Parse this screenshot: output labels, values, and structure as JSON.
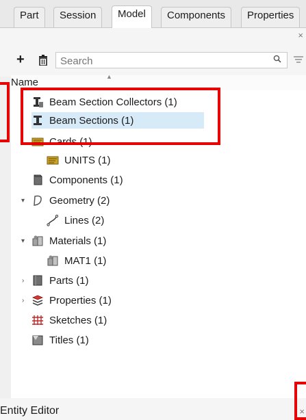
{
  "tabs": [
    {
      "label": "Part",
      "active": false
    },
    {
      "label": "Session",
      "active": false
    },
    {
      "label": "Model",
      "active": true
    },
    {
      "label": "Components",
      "active": false
    },
    {
      "label": "Properties",
      "active": false
    }
  ],
  "panel_close": "×",
  "toolbar": {
    "add_label": "+",
    "search_placeholder": "Search"
  },
  "header": {
    "name": "Name"
  },
  "tree": [
    {
      "label": "Beam Section Collectors",
      "count": "(1)",
      "icon": "beam-section-collector-icon",
      "selected": false
    },
    {
      "label": "Beam Sections",
      "count": "(1)",
      "icon": "beam-section-icon",
      "selected": true
    },
    {
      "label": "Cards",
      "count": "(1)",
      "icon": "card-icon",
      "selected": false
    },
    {
      "label": "UNITS",
      "count": "(1)",
      "icon": "card-icon",
      "selected": false
    },
    {
      "label": "Components",
      "count": "(1)",
      "icon": "component-icon",
      "selected": false
    },
    {
      "label": "Geometry",
      "count": "(2)",
      "icon": "geometry-icon",
      "expanded": true
    },
    {
      "label": "Lines",
      "count": "(2)",
      "icon": "line-icon",
      "selected": false
    },
    {
      "label": "Materials",
      "count": "(1)",
      "icon": "material-icon",
      "expanded": true
    },
    {
      "label": "MAT1",
      "count": "(1)",
      "icon": "material-icon",
      "selected": false
    },
    {
      "label": "Parts",
      "count": "(1)",
      "icon": "part-icon",
      "expanded": false
    },
    {
      "label": "Properties",
      "count": "(1)",
      "icon": "property-icon",
      "expanded": false
    },
    {
      "label": "Sketches",
      "count": "(1)",
      "icon": "sketch-icon",
      "selected": false
    },
    {
      "label": "Titles",
      "count": "(1)",
      "icon": "title-icon",
      "selected": false
    }
  ],
  "footer": {
    "title": "Entity Editor",
    "close": "×"
  },
  "colors": {
    "highlight": "#e60000",
    "selection": "#d6eaf8"
  }
}
